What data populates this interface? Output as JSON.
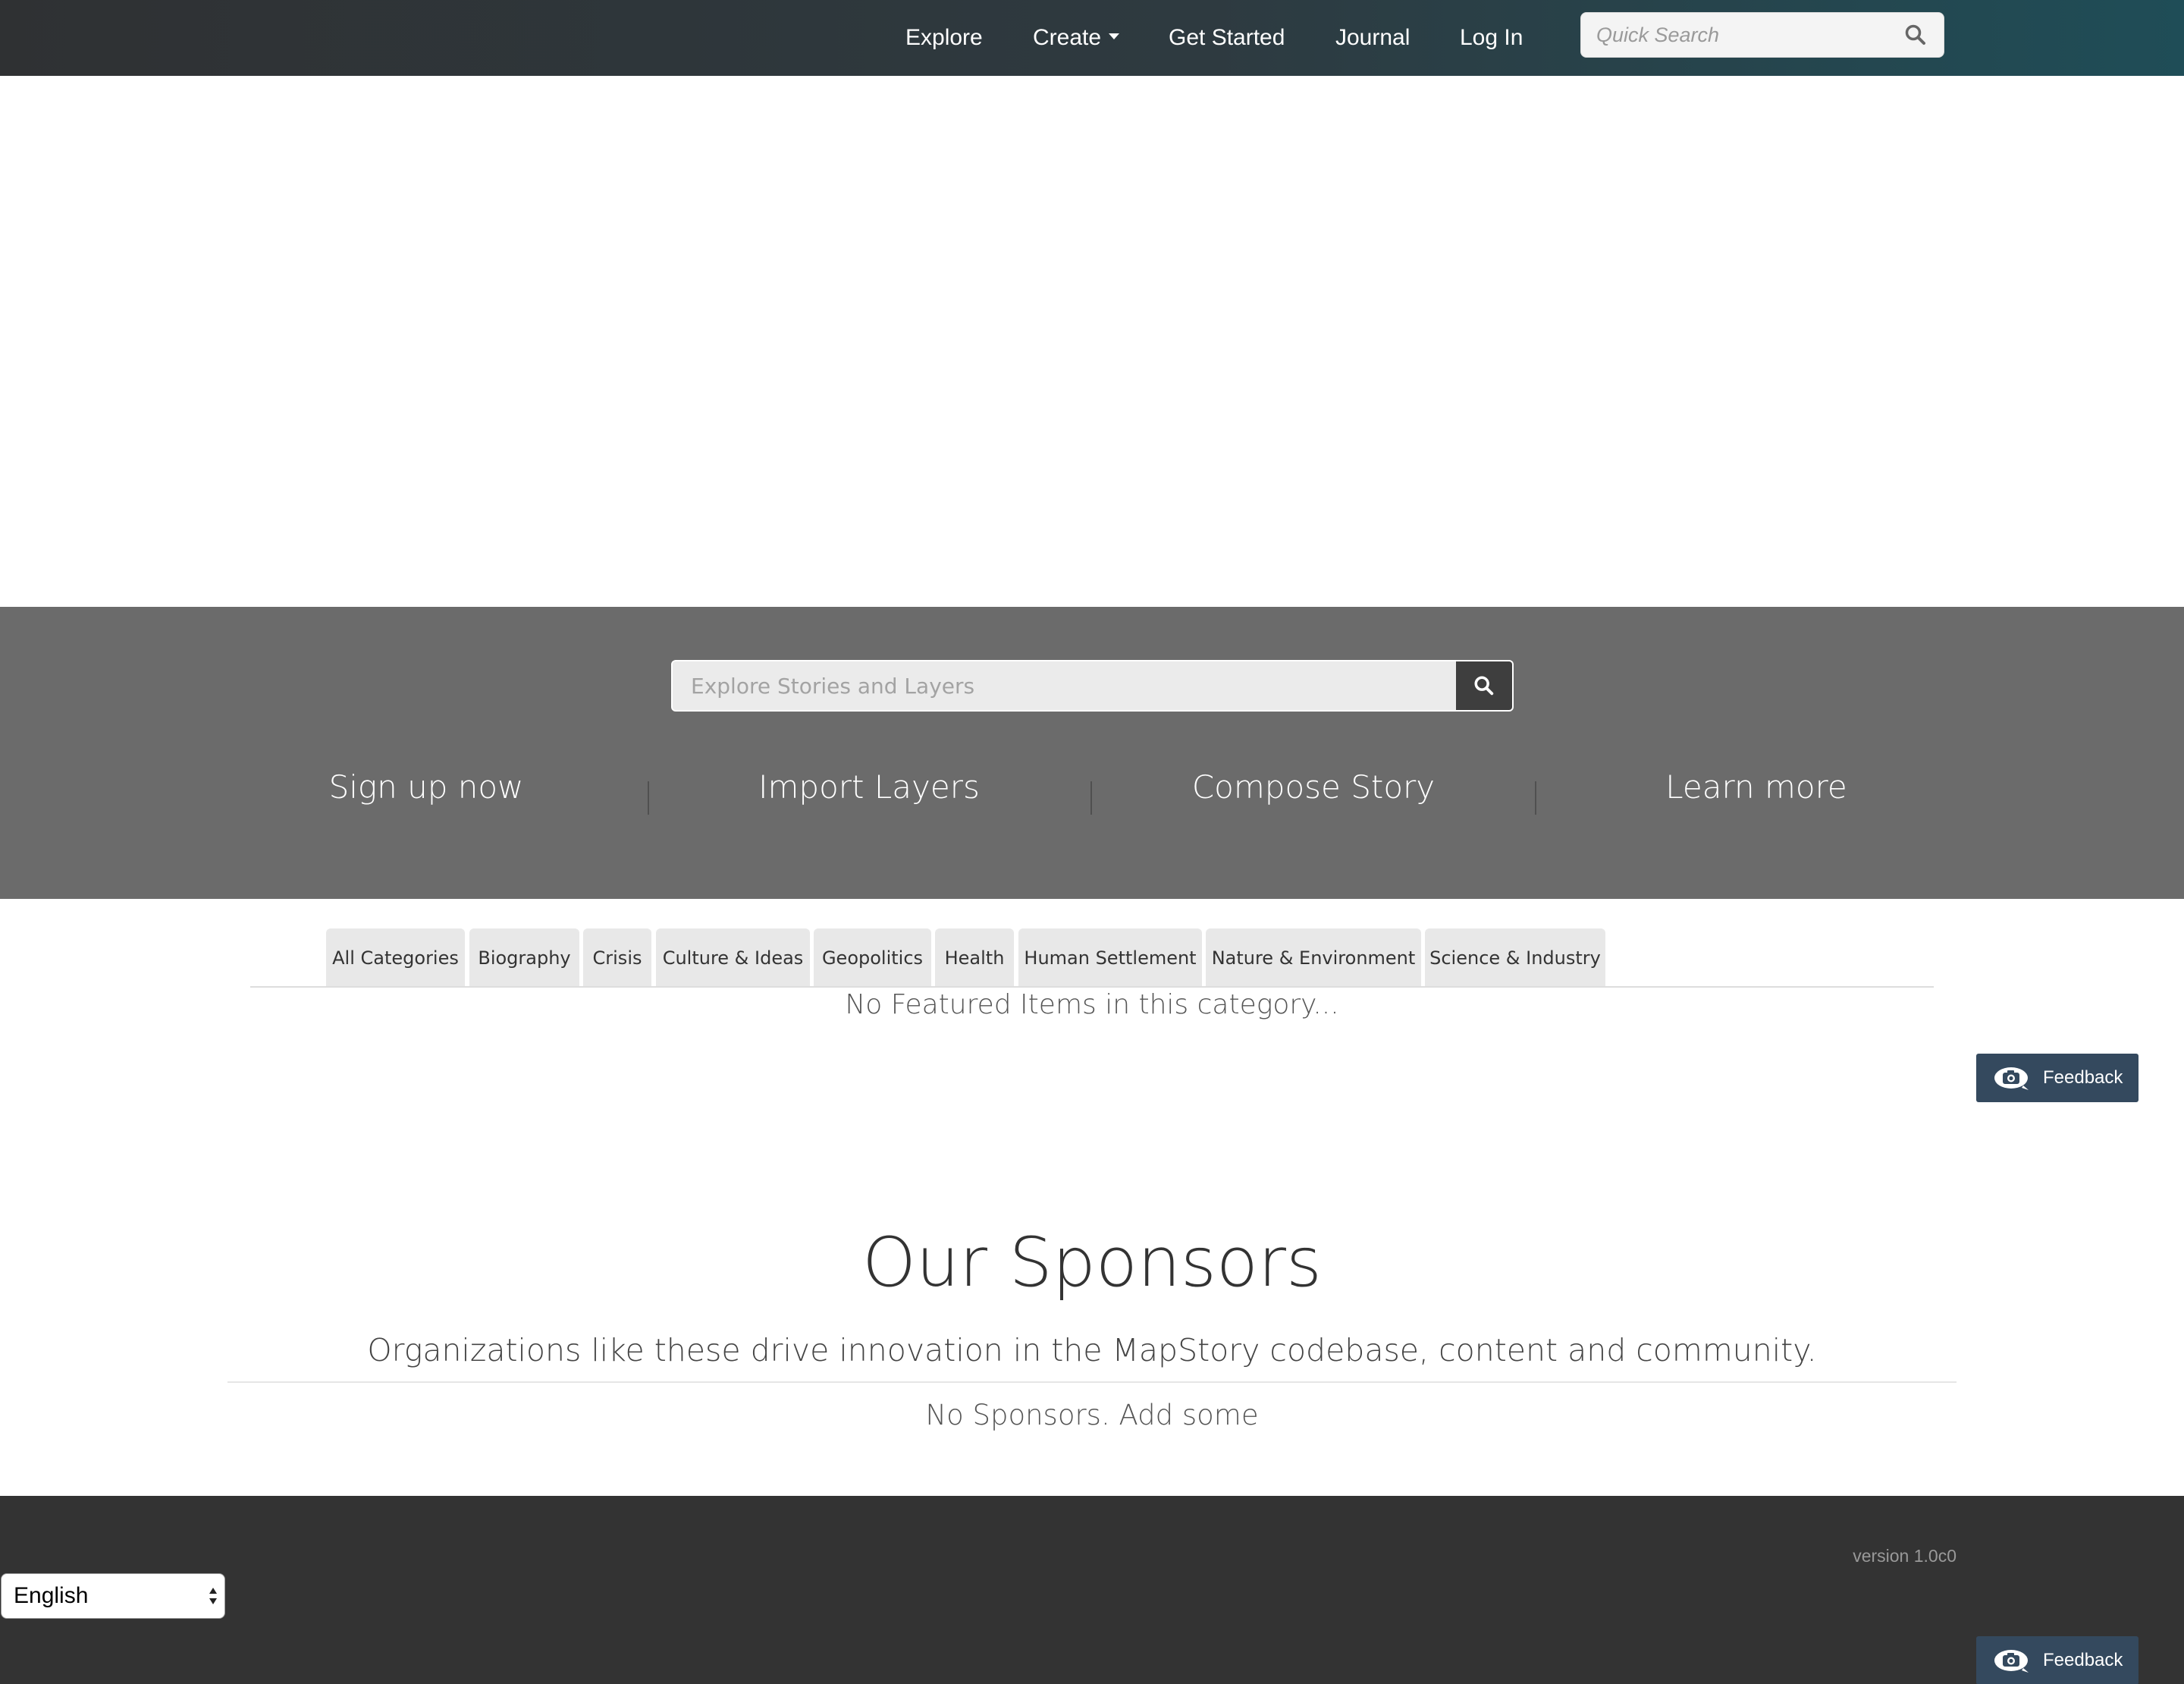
{
  "nav": {
    "links": [
      {
        "label": "Explore"
      },
      {
        "label": "Create"
      },
      {
        "label": "Get Started"
      },
      {
        "label": "Journal"
      },
      {
        "label": "Log In"
      }
    ],
    "quick_search_placeholder": "Quick Search",
    "search_icon": "search-icon"
  },
  "hero": {
    "search_placeholder": "Explore Stories and Layers",
    "search_icon": "search-icon",
    "ctas": [
      {
        "label": "Sign up now"
      },
      {
        "label": "Import Layers"
      },
      {
        "label": "Compose Story"
      },
      {
        "label": "Learn more"
      }
    ]
  },
  "categories": {
    "tabs": [
      {
        "label": "All Categories"
      },
      {
        "label": "Biography"
      },
      {
        "label": "Crisis"
      },
      {
        "label": "Culture & Ideas"
      },
      {
        "label": "Geopolitics"
      },
      {
        "label": "Health"
      },
      {
        "label": "Human Settlement"
      },
      {
        "label": "Nature & Environment"
      },
      {
        "label": "Science & Industry"
      }
    ],
    "empty_message": "No Featured Items in this category..."
  },
  "feedback": {
    "label": "Feedback",
    "icon": "camera-icon",
    "color": "#34495e"
  },
  "sponsors": {
    "title": "Our Sponsors",
    "subtitle": "Organizations like these drive innovation in the MapStory codebase, content and community.",
    "empty_message": "No Sponsors. Add some"
  },
  "footer": {
    "version": "version 1.0c0",
    "language": "English"
  },
  "colors": {
    "hero_background": "#6b6b6b",
    "footer_background": "#333333",
    "tab_background": "#e8e8e8"
  }
}
